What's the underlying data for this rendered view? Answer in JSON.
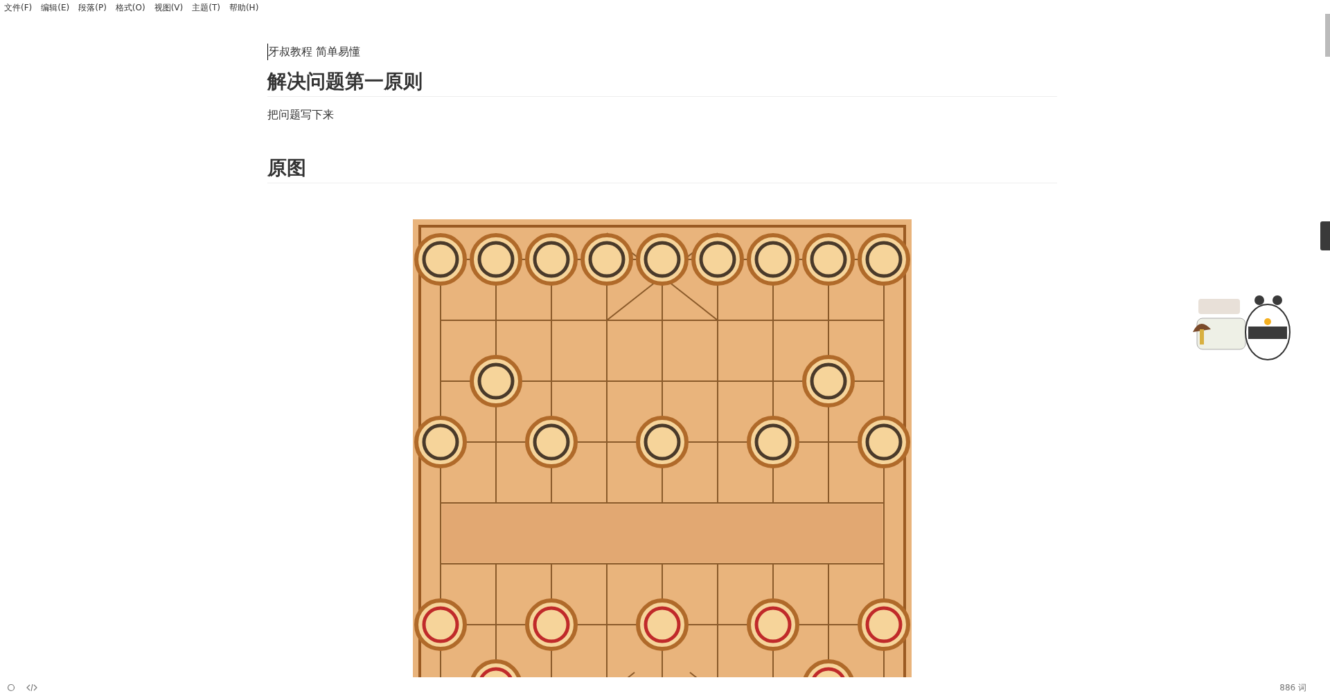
{
  "menu_bar": [
    {
      "label": "文件(F)"
    },
    {
      "label": "编辑(E)"
    },
    {
      "label": "段落(P)"
    },
    {
      "label": "格式(O)"
    },
    {
      "label": "视图(V)"
    },
    {
      "label": "主题(T)"
    },
    {
      "label": "帮助(H)"
    }
  ],
  "document": [
    {
      "kind": "paragraph",
      "text": "牙叔教程 简单易懂"
    },
    {
      "kind": "h1",
      "text": "解决问题第一原则"
    },
    {
      "kind": "paragraph",
      "text": "把问题写下来"
    },
    {
      "kind": "h2",
      "text": "原图"
    },
    {
      "kind": "image"
    }
  ],
  "status_bar": {
    "word_count": "886 词"
  }
}
